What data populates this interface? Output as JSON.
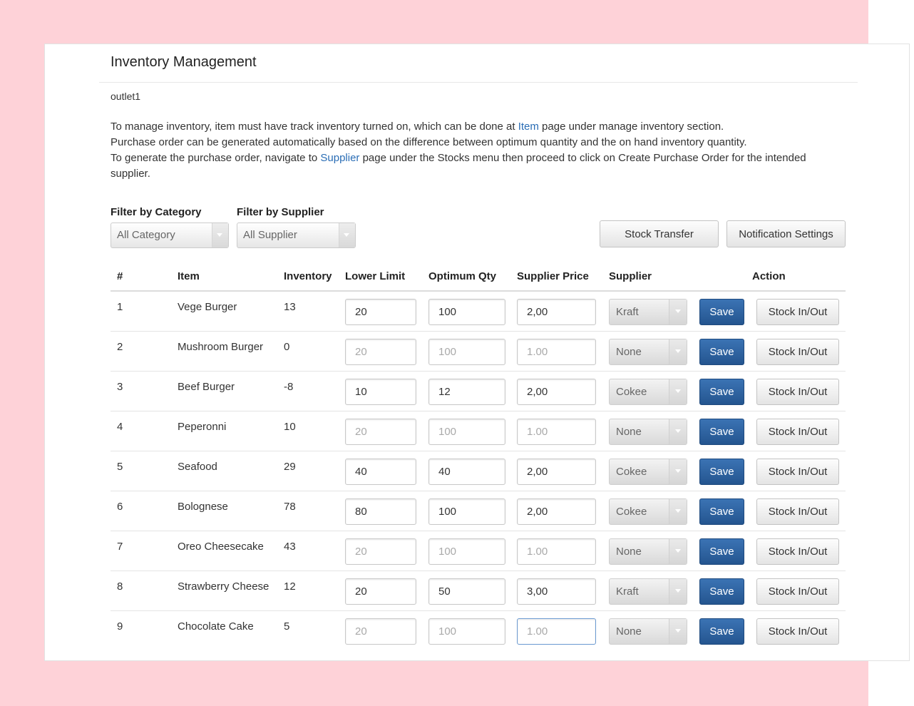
{
  "page": {
    "title": "Inventory Management",
    "outlet": "outlet1"
  },
  "info": {
    "line1_pre": "To manage inventory, item must have track inventory turned on, which can be done at ",
    "line1_link": "Item",
    "line1_post": " page under manage inventory section.",
    "line2": "Purchase order can be generated automatically based on the difference between optimum quantity and the on hand inventory quantity.",
    "line3_pre": "To generate the purchase order, navigate to ",
    "line3_link": "Supplier",
    "line3_post": " page under the Stocks menu then proceed to click on Create Purchase Order for the intended supplier."
  },
  "filters": {
    "category_label": "Filter by Category",
    "category_value": "All Category",
    "supplier_label": "Filter by Supplier",
    "supplier_value": "All Supplier"
  },
  "buttons": {
    "stock_transfer": "Stock Transfer",
    "notification_settings": "Notification Settings",
    "save": "Save",
    "stock_inout": "Stock In/Out"
  },
  "table": {
    "headers": {
      "num": "#",
      "item": "Item",
      "inventory": "Inventory",
      "lower_limit": "Lower Limit",
      "optimum_qty": "Optimum Qty",
      "supplier_price": "Supplier Price",
      "supplier": "Supplier",
      "action": "Action"
    },
    "rows": [
      {
        "num": "1",
        "item": "Vege Burger",
        "inventory": "13",
        "lower_limit": "20",
        "optimum_qty": "100",
        "supplier_price": "2,00",
        "supplier": "Kraft",
        "placeholder": false
      },
      {
        "num": "2",
        "item": "Mushroom Burger",
        "inventory": "0",
        "lower_limit": "20",
        "optimum_qty": "100",
        "supplier_price": "1.00",
        "supplier": "None",
        "placeholder": true
      },
      {
        "num": "3",
        "item": "Beef Burger",
        "inventory": "-8",
        "lower_limit": "10",
        "optimum_qty": "12",
        "supplier_price": "2,00",
        "supplier": "Cokee",
        "placeholder": false
      },
      {
        "num": "4",
        "item": "Peperonni",
        "inventory": "10",
        "lower_limit": "20",
        "optimum_qty": "100",
        "supplier_price": "1.00",
        "supplier": "None",
        "placeholder": true
      },
      {
        "num": "5",
        "item": "Seafood",
        "inventory": "29",
        "lower_limit": "40",
        "optimum_qty": "40",
        "supplier_price": "2,00",
        "supplier": "Cokee",
        "placeholder": false
      },
      {
        "num": "6",
        "item": "Bolognese",
        "inventory": "78",
        "lower_limit": "80",
        "optimum_qty": "100",
        "supplier_price": "2,00",
        "supplier": "Cokee",
        "placeholder": false
      },
      {
        "num": "7",
        "item": "Oreo Cheesecake",
        "inventory": "43",
        "lower_limit": "20",
        "optimum_qty": "100",
        "supplier_price": "1.00",
        "supplier": "None",
        "placeholder": true
      },
      {
        "num": "8",
        "item": "Strawberry Cheese",
        "inventory": "12",
        "lower_limit": "20",
        "optimum_qty": "50",
        "supplier_price": "3,00",
        "supplier": "Kraft",
        "placeholder": false
      },
      {
        "num": "9",
        "item": "Chocolate Cake",
        "inventory": "5",
        "lower_limit": "20",
        "optimum_qty": "100",
        "supplier_price": "1.00",
        "supplier": "None",
        "placeholder": true,
        "focused_field": "supplier_price"
      }
    ]
  },
  "colors": {
    "background": "#fed2d8",
    "link": "#2a6db5",
    "save_button": "#2d5f9e"
  }
}
